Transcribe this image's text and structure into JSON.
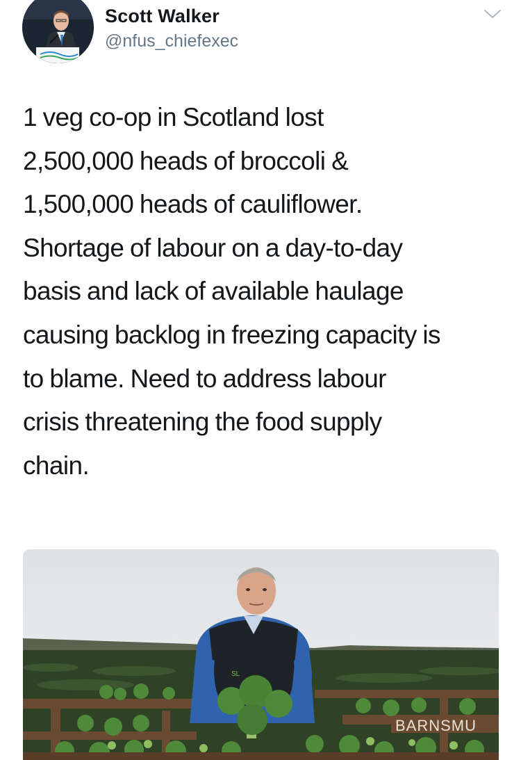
{
  "author": {
    "display_name": "Scott Walker",
    "handle": "@nfus_chiefexec",
    "avatar_icon": "profile-photo",
    "menu_icon": "chevron-down-icon"
  },
  "tweet": {
    "lines": [
      "1 veg co-op in Scotland lost",
      "2,500,000 heads of broccoli &",
      "1,500,000 heads of cauliflower.",
      "Shortage of labour on a day-to-day",
      "basis and lack of available haulage",
      "causing backlog in freezing capacity is",
      "to blame. Need to address labour",
      "crisis threatening the food supply",
      "chain."
    ]
  },
  "media": {
    "description": "",
    "crate_text": "BARNSMU",
    "jersey_text": "SL",
    "colors": {
      "sky": "#e6e8ea",
      "field": "#2f4226",
      "jumper": "#2f63ad",
      "gilet": "#1e2328",
      "broccoli": "#4f8a3a",
      "crate": "#6b4a32"
    }
  },
  "colors": {
    "text": "#14171a",
    "secondary": "#657786",
    "chevron": "#aab8c2"
  }
}
